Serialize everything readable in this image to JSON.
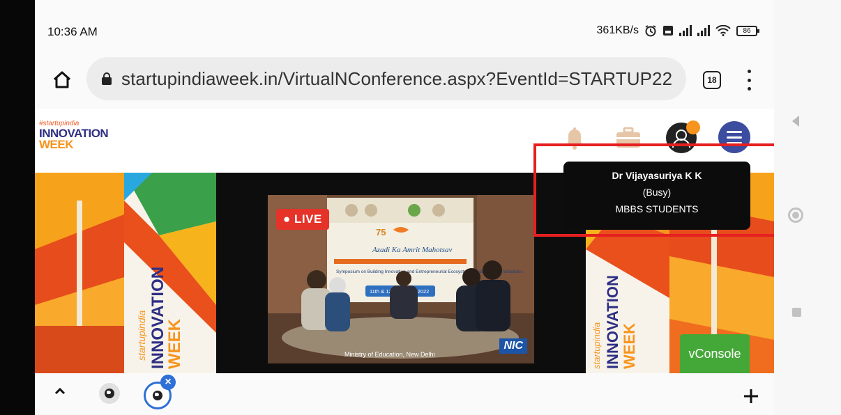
{
  "status_bar": {
    "time": "10:36 AM",
    "net_speed": "361KB/s",
    "battery": "86",
    "icons": [
      "alarm-icon",
      "sim-icon",
      "signal-icon",
      "signal-icon",
      "wifi-icon",
      "battery-icon"
    ]
  },
  "browser": {
    "url": "startupindiaweek.in/VirtualNConference.aspx?EventId=STARTUP22",
    "tab_count": "18",
    "icons": [
      "home-icon",
      "lock-icon",
      "tab-switcher-icon",
      "more-vert-icon"
    ]
  },
  "site": {
    "logo": {
      "tag": "#startupindia",
      "line1": "INNOVATION",
      "line2": "WEEK"
    },
    "header_icons": [
      "bell-icon",
      "briefcase-icon",
      "user-avatar-icon",
      "hamburger-icon"
    ],
    "accent": "#f7941d",
    "menu_color": "#3c4c9f"
  },
  "stream": {
    "live_label": "LIVE",
    "badge": "NIC",
    "caption": "Ministry of Education, New Delhi",
    "screen_text": {
      "azadi": "Azadi Ka Amrit Mahotsav",
      "symposium": "Symposium on Building Innovation and Entrepreneurial Ecosystem in Educational Institutions",
      "dates": "11th & 12th January 2022"
    }
  },
  "tooltip": {
    "name": "Dr Vijayasuriya K K",
    "status": "(Busy)",
    "group": "MBBS STUDENTS",
    "highlight_color": "#e62020"
  },
  "vconsole": {
    "label": "vConsole",
    "color": "#44a838"
  },
  "bottom_bar": {
    "icons": [
      "caret-up-icon",
      "globe-icon",
      "globe-icon",
      "close-icon",
      "plus-icon"
    ]
  },
  "android_nav": {
    "icons": [
      "back-icon",
      "home-circle-icon",
      "recents-icon"
    ]
  }
}
